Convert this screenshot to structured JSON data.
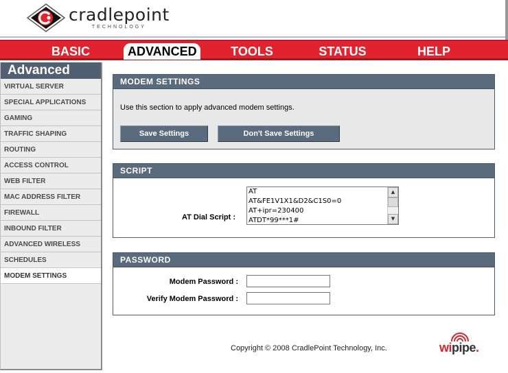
{
  "brand": {
    "name": "cradlepoint",
    "sub": "TECHNOLOGY",
    "accent": "#e0232f",
    "panel_color": "#5a6b7d"
  },
  "nav": {
    "tabs": [
      {
        "label": "BASIC"
      },
      {
        "label": "ADVANCED",
        "active": true
      },
      {
        "label": "TOOLS"
      },
      {
        "label": "STATUS"
      },
      {
        "label": "HELP"
      }
    ]
  },
  "sidebar": {
    "title": "Advanced",
    "items": [
      {
        "label": "VIRTUAL SERVER"
      },
      {
        "label": "SPECIAL APPLICATIONS"
      },
      {
        "label": "GAMING"
      },
      {
        "label": "TRAFFIC SHAPING"
      },
      {
        "label": "ROUTING"
      },
      {
        "label": "ACCESS CONTROL"
      },
      {
        "label": "WEB FILTER"
      },
      {
        "label": "MAC ADDRESS FILTER"
      },
      {
        "label": "FIREWALL"
      },
      {
        "label": "INBOUND FILTER"
      },
      {
        "label": "ADVANCED WIRELESS"
      },
      {
        "label": "SCHEDULES"
      },
      {
        "label": "MODEM SETTINGS",
        "active": true
      }
    ]
  },
  "modem_settings": {
    "title": "MODEM SETTINGS",
    "description": "Use this section to apply advanced modem settings.",
    "save_label": "Save Settings",
    "dont_save_label": "Don't Save Settings"
  },
  "script": {
    "title": "SCRIPT",
    "at_dial_label": "AT Dial Script :",
    "lines": [
      "AT",
      "AT&FE1V1X1&D2&C1S0=0",
      "AT+ipr=230400",
      "ATDT*99***1#"
    ]
  },
  "password": {
    "title": "PASSWORD",
    "modem_password_label": "Modem Password :",
    "verify_password_label": "Verify Modem Password :",
    "modem_password_value": "",
    "verify_password_value": ""
  },
  "footer": {
    "copyright": "Copyright © 2008 CradlePoint Technology, Inc.",
    "partner_logo_pre": "wi",
    "partner_logo_post": "pipe",
    "partner_logo_dot": "."
  }
}
